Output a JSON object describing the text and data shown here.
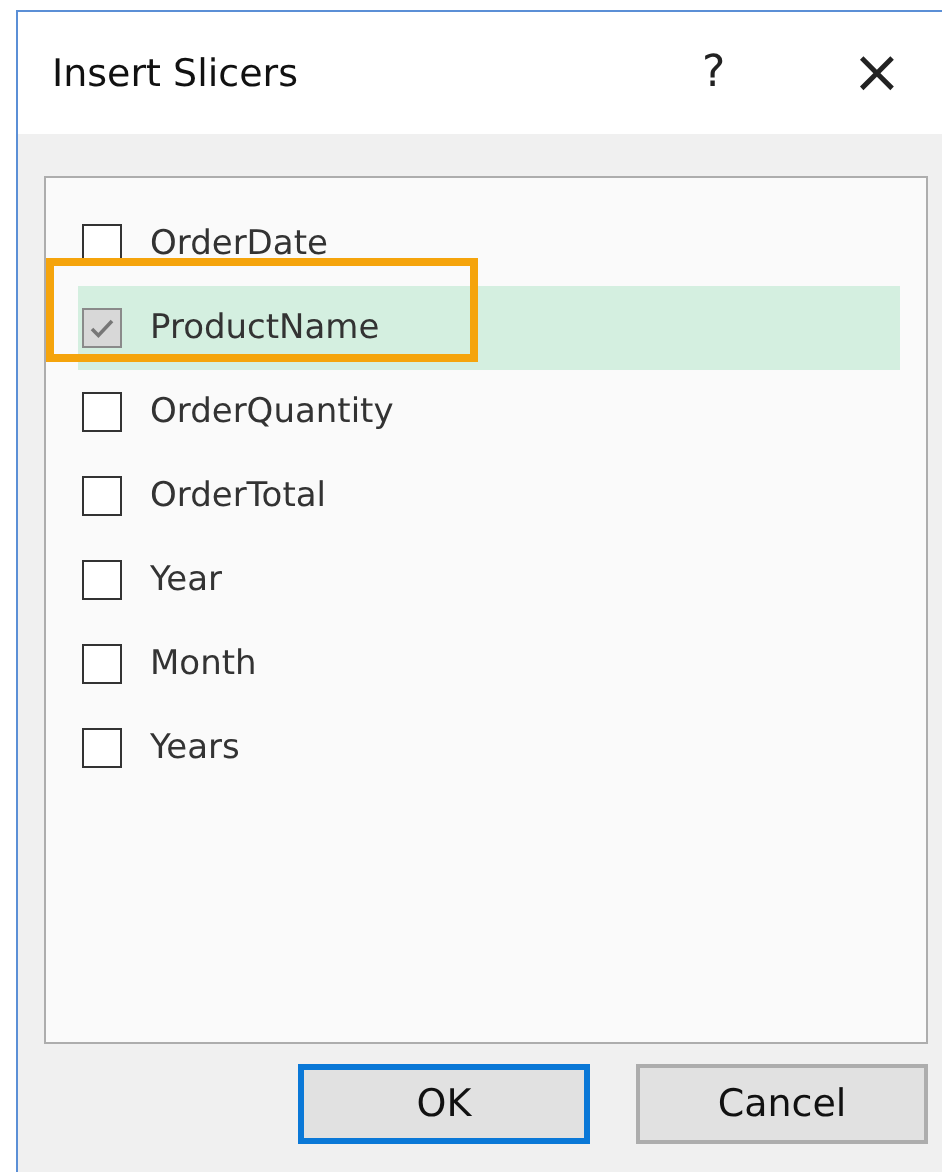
{
  "window": {
    "title": "Insert Slicers",
    "help": "?",
    "close": "×"
  },
  "fields": [
    {
      "label": "OrderDate",
      "checked": false,
      "selected": false,
      "highlighted": false
    },
    {
      "label": "ProductName",
      "checked": true,
      "selected": true,
      "highlighted": true
    },
    {
      "label": "OrderQuantity",
      "checked": false,
      "selected": false,
      "highlighted": false
    },
    {
      "label": "OrderTotal",
      "checked": false,
      "selected": false,
      "highlighted": false
    },
    {
      "label": "Year",
      "checked": false,
      "selected": false,
      "highlighted": false
    },
    {
      "label": "Month",
      "checked": false,
      "selected": false,
      "highlighted": false
    },
    {
      "label": "Years",
      "checked": false,
      "selected": false,
      "highlighted": false
    }
  ],
  "buttons": [
    {
      "label": "OK",
      "default": true
    },
    {
      "label": "Cancel",
      "default": false
    }
  ]
}
